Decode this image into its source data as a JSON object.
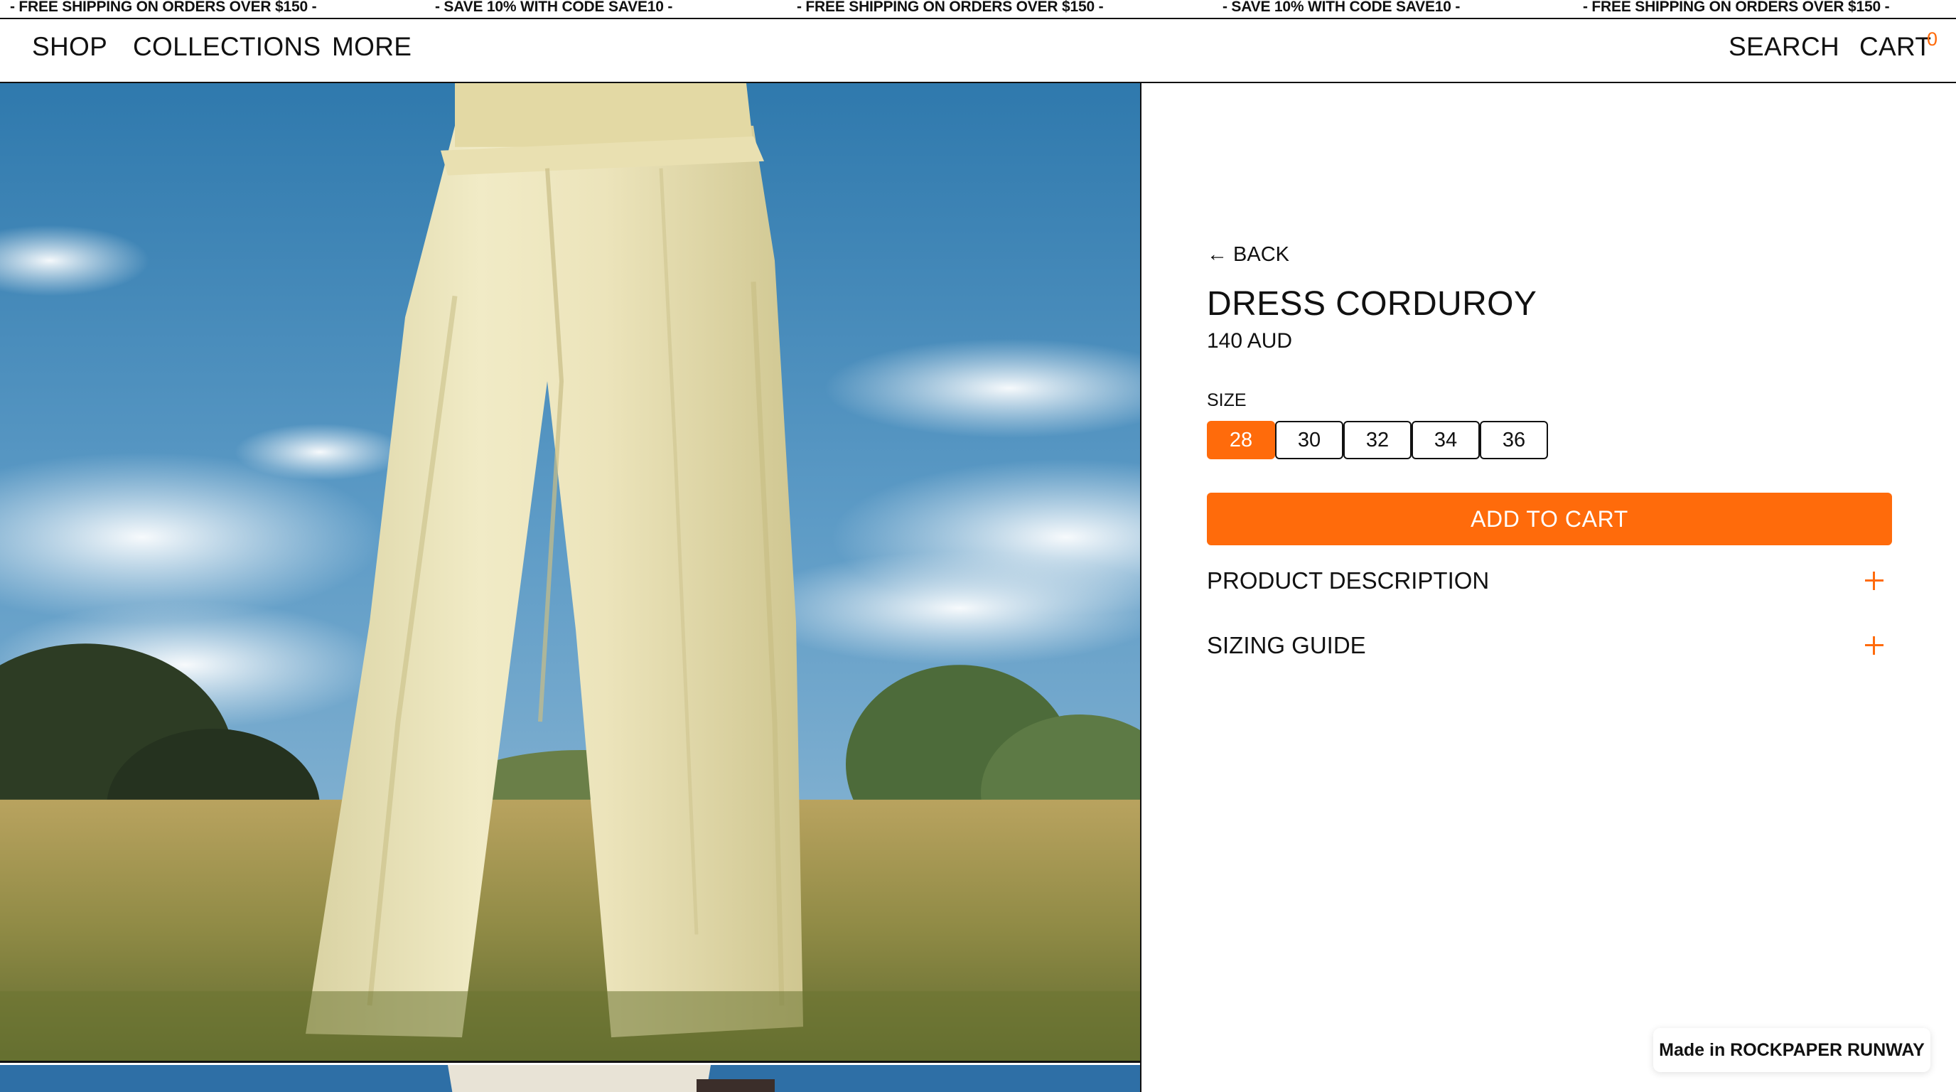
{
  "announcement": {
    "messages": [
      "- FREE SHIPPING ON ORDERS OVER $150 -",
      "- SAVE 10% WITH CODE SAVE10 -",
      "- FREE SHIPPING ON ORDERS OVER $150 -",
      "- SAVE 10% WITH CODE SAVE10 -",
      "- FREE SHIPPING ON ORDERS OVER $150 -"
    ]
  },
  "nav": {
    "left": [
      "SHOP",
      "COLLECTIONS",
      "MORE"
    ],
    "search_label": "SEARCH",
    "cart_label": "CART",
    "cart_count": "0"
  },
  "product": {
    "back_label": "← BACK",
    "title": "DRESS CORDUROY",
    "price": "140 AUD",
    "size_label": "SIZE",
    "sizes": [
      "28",
      "30",
      "32",
      "34",
      "36"
    ],
    "selected_size": "28",
    "add_to_cart_label": "ADD TO CART",
    "accordions": [
      "PRODUCT DESCRIPTION",
      "SIZING GUIDE"
    ]
  },
  "badge": {
    "text": "Made in ROCKPAPER RUNWAY"
  },
  "colors": {
    "accent": "#ff6b0b",
    "text": "#111111",
    "background": "#ffffff"
  },
  "icons": {
    "back": "arrow-left-icon",
    "accordion": "plus-icon"
  }
}
